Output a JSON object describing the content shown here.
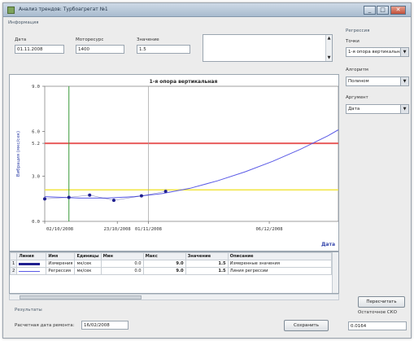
{
  "window": {
    "title": "Анализ трендов: Турбоагрегат №1",
    "min_glyph": "_",
    "max_glyph": "□",
    "close_glyph": "✕"
  },
  "info": {
    "section_label": "Информация",
    "date_label": "Дата",
    "date_value": "01.11.2008",
    "motor_label": "Моторесурс",
    "motor_value": "1400",
    "value_label": "Значение",
    "value_value": "1.5"
  },
  "regression": {
    "section_label": "Регрессия",
    "point_label": "Точки",
    "point_value": "1-я опора вертикальная",
    "algo_label": "Алгоритм",
    "algo_value": "Полином",
    "arg_label": "Аргумент",
    "arg_value": "Дата"
  },
  "chart_data": {
    "type": "line",
    "title": "1-я опора вертикальная",
    "xlabel": "Дата",
    "ylabel": "Вибрация (мкс/сек)",
    "ylim": [
      0,
      9.0
    ],
    "y_ticks": [
      "0.0",
      "3.0",
      "5.2",
      "6.0",
      "9.0"
    ],
    "x_ticks": [
      "02/10/2008",
      "23/10/2008",
      "01/11/2008",
      "06/12/2008"
    ],
    "x_tick_days": [
      0,
      21,
      30,
      65
    ],
    "xlim_days": [
      0,
      85
    ],
    "measurements": {
      "name": "Измерения",
      "days": [
        0,
        7,
        13,
        20,
        28,
        35
      ],
      "values": [
        1.5,
        1.6,
        1.75,
        1.4,
        1.7,
        2.0
      ]
    },
    "regression": {
      "name": "Регрессия",
      "days": [
        0,
        10,
        18,
        26,
        34,
        42,
        50,
        58,
        66,
        74,
        82,
        85
      ],
      "values": [
        1.65,
        1.55,
        1.55,
        1.65,
        1.85,
        2.2,
        2.7,
        3.3,
        4.0,
        4.8,
        5.7,
        6.1
      ]
    },
    "threshold_red": 5.2,
    "threshold_yellow": 2.1,
    "cursor_green_day": 7,
    "cursor_gray_day": 30,
    "colors": {
      "measurements": "#1f1f8f",
      "regression": "#5a5ae6",
      "red": "#e85b5b",
      "yellow": "#f2e64a",
      "green": "#3a9a3a",
      "cursor": "#a0a0a0"
    }
  },
  "table": {
    "headers": [
      "Линия",
      "Имя",
      "Единицы",
      "Мин",
      "Макс",
      "Значение",
      "Описание"
    ],
    "rows": [
      {
        "num": "1",
        "name": "Измерения",
        "units": "мк/сек",
        "min": "0.0",
        "max": "9.0",
        "value": "1.5",
        "desc": "Измеренные значения",
        "line_color": "#1f1f8f",
        "line_thick": 3
      },
      {
        "num": "2",
        "name": "Регрессия",
        "units": "мк/сек",
        "min": "0.0",
        "max": "9.0",
        "value": "1.5",
        "desc": "Линия регрессии",
        "line_color": "#5a5ae6",
        "line_thick": 1
      }
    ]
  },
  "results": {
    "section_label": "Результаты",
    "repair_label": "Расчетная дата ремонта:",
    "repair_value": "16/02/2008",
    "save_label": "Сохранить",
    "recalc_label": "Пересчитать",
    "sko_label": "Остаточное СКО",
    "sko_value": "0.0164"
  }
}
